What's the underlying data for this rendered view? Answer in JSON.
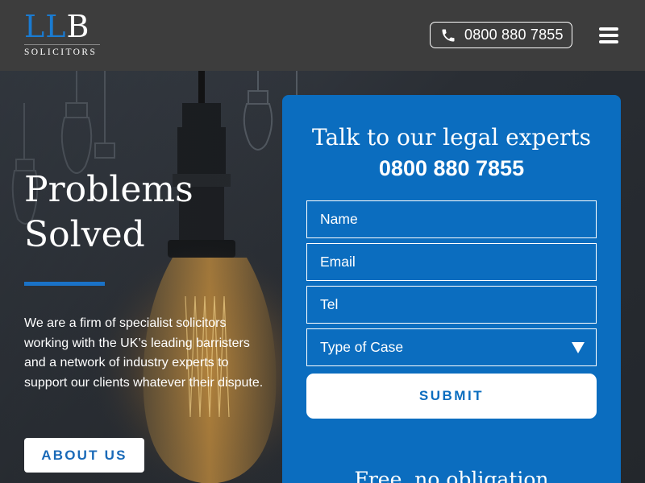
{
  "header": {
    "logo": {
      "mark_l1": "L",
      "mark_l2": "L",
      "mark_b": "B",
      "subtitle": "SOLICITORS"
    },
    "phone_button": {
      "icon": "phone-icon",
      "number": "0800 880 7855"
    },
    "menu_icon": "hamburger-menu-icon"
  },
  "hero": {
    "title_line1": "Problems",
    "title_line2": "Solved",
    "description": "We are a firm of specialist solicitors working with the UK’s leading barristers and a network of industry experts to support our clients whatever their dispute.",
    "about_button": "ABOUT US"
  },
  "form": {
    "title": "Talk to our legal experts",
    "phone": "0800 880 7855",
    "name_placeholder": "Name",
    "email_placeholder": "Email",
    "tel_placeholder": "Tel",
    "case_select_value": "Type of Case",
    "submit_label": "SUBMIT",
    "footer_text": "Free, no obligation"
  },
  "colors": {
    "header_bg": "#3d3d3d",
    "brand_blue": "#0b6dbf",
    "accent_blue": "#1a7bd1",
    "white": "#ffffff"
  }
}
